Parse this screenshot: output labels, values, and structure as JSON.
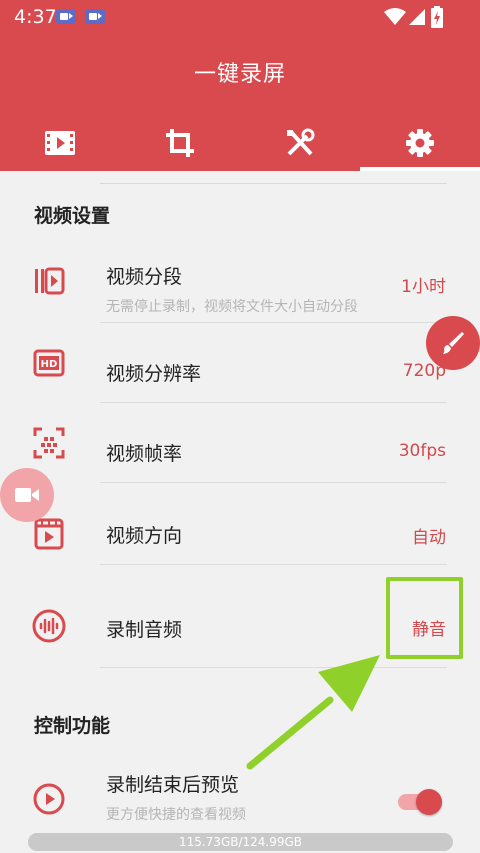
{
  "status_bar": {
    "time": "4:37",
    "notification_icons": [
      "video-camera-icon",
      "video-camera-icon"
    ],
    "right_icons": [
      "wifi-icon",
      "signal-icon",
      "battery-charging-icon"
    ]
  },
  "app": {
    "title": "一键录屏",
    "accent_color": "#d94a4e"
  },
  "tabs": [
    {
      "icon": "video-film-icon",
      "active": false
    },
    {
      "icon": "crop-icon",
      "active": false
    },
    {
      "icon": "tools-icon",
      "active": false
    },
    {
      "icon": "gear-icon",
      "active": true
    }
  ],
  "sections": {
    "video_settings": {
      "title": "视频设置",
      "items": [
        {
          "icon": "video-segment-icon",
          "label": "视频分段",
          "subtitle": "无需停止录制，视频将文件大小自动分段",
          "value": "1小时"
        },
        {
          "icon": "hd-icon",
          "label": "视频分辨率",
          "value": "720p"
        },
        {
          "icon": "frame-rate-icon",
          "label": "视频帧率",
          "value": "30fps"
        },
        {
          "icon": "video-orientation-icon",
          "label": "视频方向",
          "value": "自动"
        },
        {
          "icon": "audio-wave-icon",
          "label": "录制音频",
          "value": "静音"
        }
      ]
    },
    "control_functions": {
      "title": "控制功能",
      "items": [
        {
          "icon": "play-circle-icon",
          "label": "录制结束后预览",
          "subtitle": "更方便快捷的查看视频",
          "toggle_on": true
        }
      ]
    }
  },
  "floating_buttons": [
    "brush-icon",
    "video-camera-icon"
  ],
  "storage": {
    "text": "115.73GB/124.99GB"
  }
}
